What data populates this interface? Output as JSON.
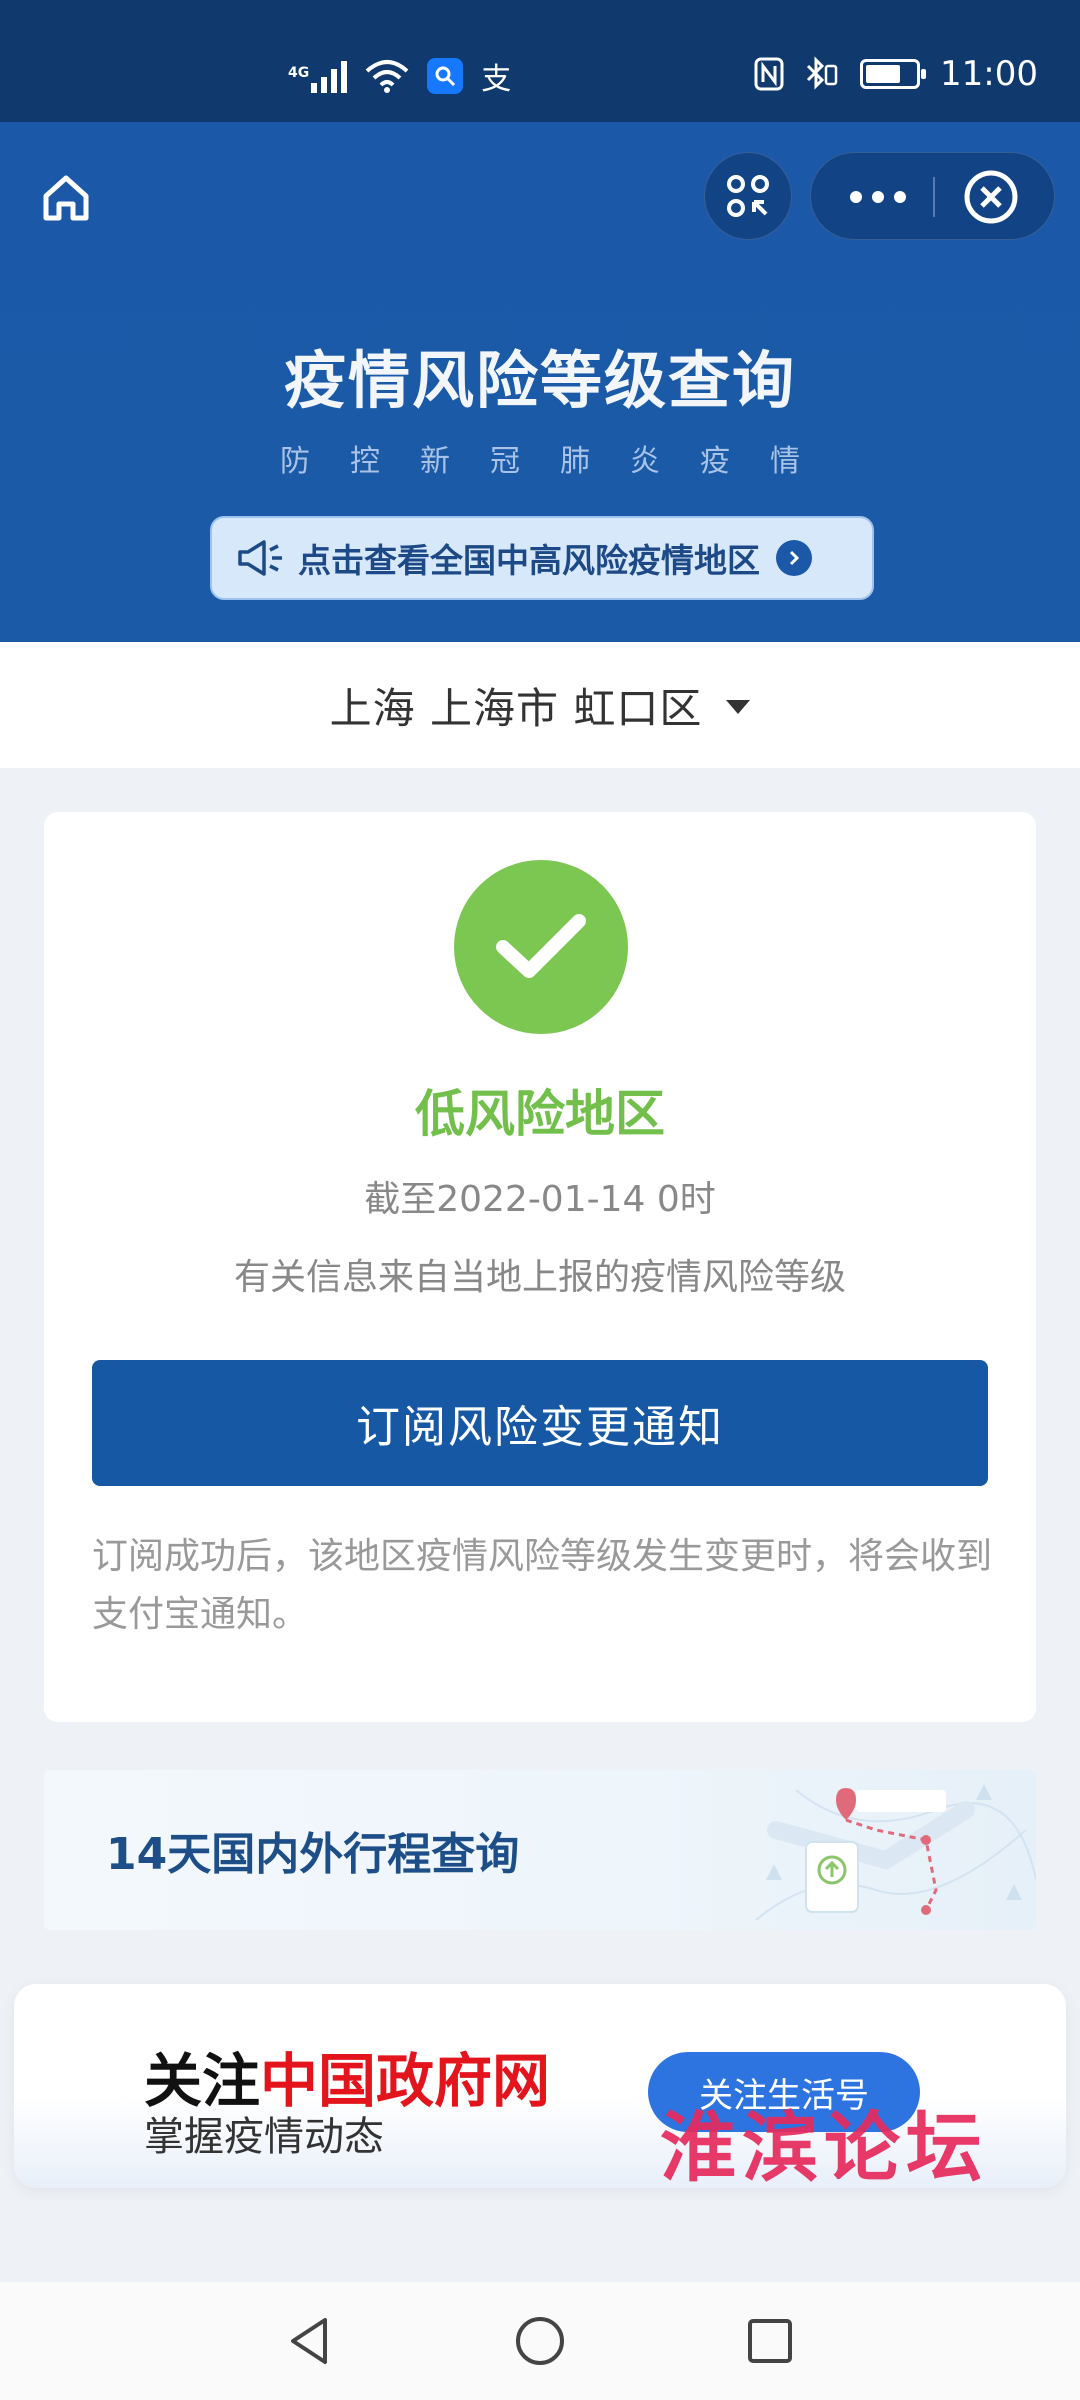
{
  "status_bar": {
    "network": "4G",
    "alipay_badge": "支",
    "time": "11:00",
    "battery_level": 0.7
  },
  "header": {
    "title": "疫情风险等级查询",
    "subtitle": "防控新冠肺炎疫情",
    "notice": "点击查看全国中高风险疫情地区"
  },
  "location": {
    "text": "上海 上海市 虹口区"
  },
  "result": {
    "level": "低风险地区",
    "as_of": "截至2022-01-14 0时",
    "source": "有关信息来自当地上报的疫情风险等级",
    "subscribe_button": "订阅风险变更通知",
    "subscribe_desc": "订阅成功后，该地区疫情风险等级发生变更时，将会收到支付宝通知。",
    "status_color": "#7cc652"
  },
  "trip_banner": {
    "label": "14天国内外行程查询"
  },
  "follow": {
    "title_prefix": "关注",
    "title_highlight": "中国政府网",
    "subtitle": "掌握疫情动态",
    "button": "关注生活号"
  },
  "watermark": "淮滨论坛",
  "colors": {
    "header_bg": "#1b59a8",
    "primary_button": "#1658a4",
    "highlight_red": "#e3141c"
  }
}
